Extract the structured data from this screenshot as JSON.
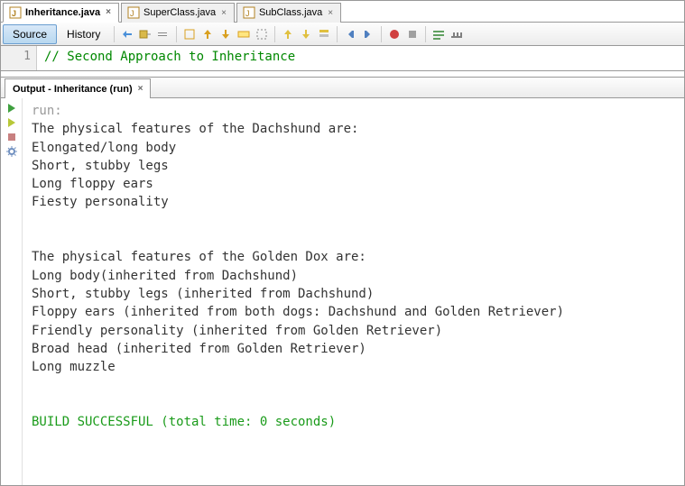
{
  "editorTabs": [
    {
      "label": "Inheritance.java",
      "active": true
    },
    {
      "label": "SuperClass.java",
      "active": false
    },
    {
      "label": "SubClass.java",
      "active": false
    }
  ],
  "sourceHistory": {
    "source": "Source",
    "history": "History"
  },
  "code": {
    "lineNo": "1",
    "comment": "// Second Approach to Inheritance"
  },
  "output": {
    "title": "Output - Inheritance (run)",
    "runLabel": "run:",
    "lines": [
      "The physical features of the Dachshund are:",
      "Elongated/long body",
      "Short, stubby legs",
      "Long floppy ears",
      "Fiesty personality",
      "",
      "",
      "The physical features of the Golden Dox are:",
      "Long body(inherited from Dachshund)",
      "Short, stubby legs (inherited from Dachshund)",
      "Floppy ears (inherited from both dogs: Dachshund and Golden Retriever)",
      "Friendly personality (inherited from Golden Retriever)",
      "Broad head (inherited from Golden Retriever)",
      "Long muzzle",
      "",
      ""
    ],
    "buildMessage": "BUILD SUCCESSFUL (total time: 0 seconds)"
  }
}
